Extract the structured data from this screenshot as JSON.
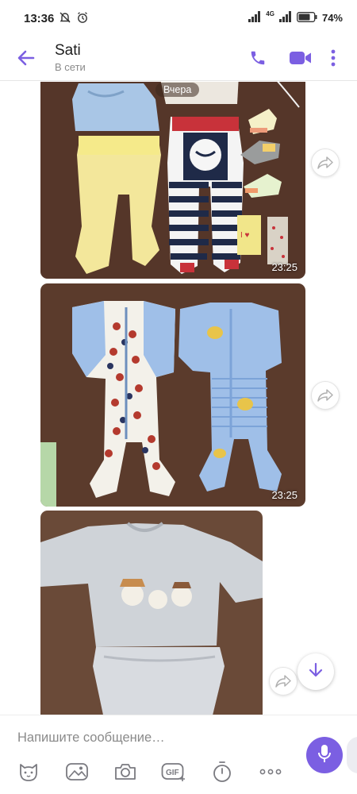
{
  "status_bar": {
    "time": "13:36",
    "battery": "74%",
    "network": "4G"
  },
  "header": {
    "contact_name": "Sati",
    "contact_status": "В сети"
  },
  "chat": {
    "date_label": "Вчера",
    "messages": [
      {
        "kind": "photo",
        "time": "23:25"
      },
      {
        "kind": "photo",
        "time": "23:25"
      },
      {
        "kind": "photo",
        "time": ""
      }
    ]
  },
  "composer": {
    "placeholder": "Напишите сообщение…"
  },
  "colors": {
    "accent": "#7b5fe2",
    "photo_bg": "#5a3a2c"
  },
  "icons": [
    "back-arrow-icon",
    "phone-icon",
    "video-call-icon",
    "more-vertical-icon",
    "forward-icon",
    "scroll-down-icon",
    "sticker-icon",
    "gallery-icon",
    "camera-icon",
    "gif-icon",
    "timer-icon",
    "more-horizontal-icon",
    "mic-icon"
  ]
}
